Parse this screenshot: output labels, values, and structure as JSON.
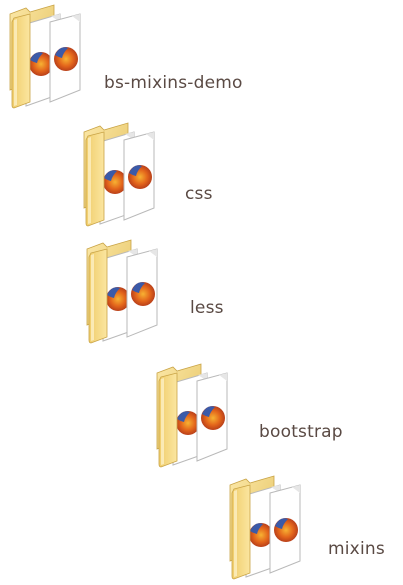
{
  "folders": [
    {
      "name": "bs-mixins-demo",
      "icon": "folder-icon"
    },
    {
      "name": "css",
      "icon": "folder-icon"
    },
    {
      "name": "less",
      "icon": "folder-icon"
    },
    {
      "name": "bootstrap",
      "icon": "folder-icon"
    },
    {
      "name": "mixins",
      "icon": "folder-icon"
    }
  ]
}
